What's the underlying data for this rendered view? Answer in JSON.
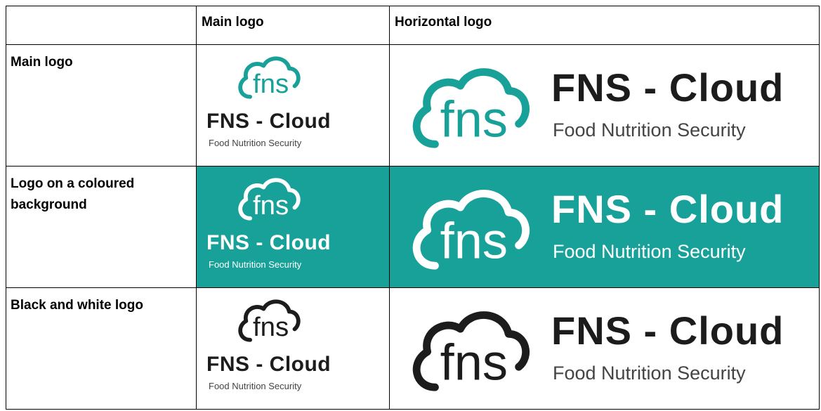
{
  "table": {
    "header": {
      "corner": "",
      "col_main": "Main logo",
      "col_horizontal": "Horizontal logo"
    },
    "rows": [
      {
        "label": "Main logo",
        "variant": "colour",
        "cloud_color": "#18a199",
        "word_color": "#1c1c1c",
        "tag_color": "#444444",
        "background": "#ffffff"
      },
      {
        "label": "Logo on a coloured background",
        "variant": "reversed",
        "cloud_color": "#ffffff",
        "word_color": "#ffffff",
        "tag_color": "#ffffff",
        "background": "#18a199"
      },
      {
        "label": "Black and white logo",
        "variant": "mono",
        "cloud_color": "#1c1c1c",
        "word_color": "#1c1c1c",
        "tag_color": "#444444",
        "background": "#ffffff"
      }
    ]
  },
  "logo": {
    "wordmark": "FNS - Cloud",
    "tagline": "Food Nutrition Security",
    "icon_letters": "fns",
    "icon": "cloud-fns-icon"
  }
}
